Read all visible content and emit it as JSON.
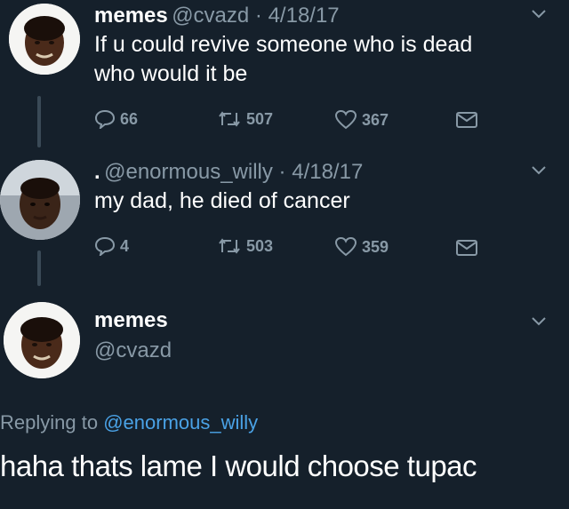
{
  "colors": {
    "background": "#15202b",
    "text": "#ffffff",
    "muted": "#8899a6",
    "link": "#4aa2e6"
  },
  "tweets": [
    {
      "name": "memes",
      "handle_date": "@cvazd · 4/18/17",
      "text_line1": "If u could revive someone who is dead",
      "text_line2": "who would it be",
      "replies": "66",
      "retweets": "507",
      "likes": "367",
      "icons": [
        "reply-icon",
        "retweet-icon",
        "like-icon",
        "dm-icon"
      ]
    },
    {
      "name": ".",
      "handle_date": "@enormous_willy · 4/18/17",
      "text_line1": "my dad, he died of cancer",
      "replies": "4",
      "retweets": "503",
      "likes": "359",
      "icons": [
        "reply-icon",
        "retweet-icon",
        "like-icon",
        "dm-icon"
      ]
    }
  ],
  "reply": {
    "name": "memes",
    "handle": "@cvazd",
    "replying_prefix": "Replying to",
    "replying_to": "@enormous_willy",
    "text": "haha thats lame I would choose tupac"
  }
}
